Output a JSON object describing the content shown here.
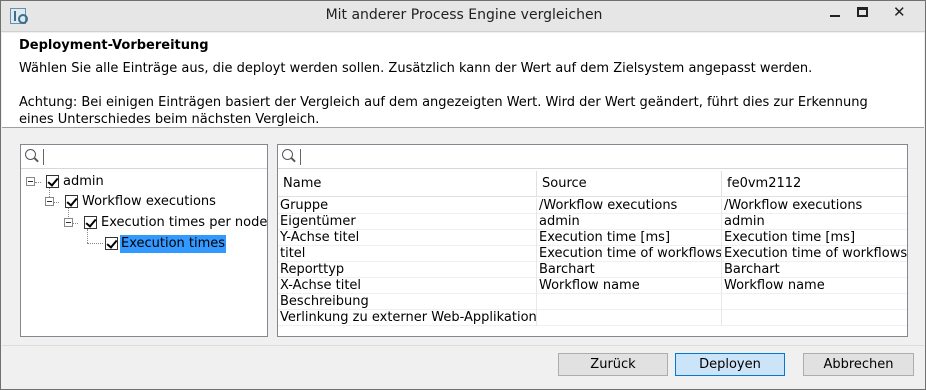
{
  "window": {
    "title": "Mit anderer Process Engine vergleichen",
    "close_glyph": "✕"
  },
  "header": {
    "title": "Deployment-Vorbereitung",
    "description": "Wählen Sie alle Einträge aus, die deployt werden sollen. Zusätzlich kann der Wert auf dem Zielsystem angepasst werden.",
    "warning": "Achtung: Bei einigen Einträgen basiert der Vergleich auf dem angezeigten Wert. Wird der Wert geändert, führt dies zur Erkennung eines Unterschiedes beim nächsten Vergleich."
  },
  "tree": {
    "items": [
      {
        "label": "admin",
        "checked": true,
        "expanded": true,
        "level": 0
      },
      {
        "label": "Workflow executions",
        "checked": true,
        "expanded": true,
        "level": 1
      },
      {
        "label": "Execution times per node",
        "checked": true,
        "expanded": true,
        "level": 2
      },
      {
        "label": "Execution times",
        "checked": true,
        "selected": true,
        "level": 3
      }
    ]
  },
  "table": {
    "columns": [
      "Name",
      "Source",
      "fe0vm2112"
    ],
    "rows": [
      [
        "Gruppe",
        "/Workflow executions",
        "/Workflow executions"
      ],
      [
        "Eigentümer",
        "admin",
        "admin"
      ],
      [
        "Y-Achse titel",
        "Execution time [ms]",
        "Execution time [ms]"
      ],
      [
        "titel",
        "Execution time of workflows",
        "Execution time of workflows"
      ],
      [
        "Reporttyp",
        "Barchart",
        "Barchart"
      ],
      [
        "X-Achse titel",
        "Workflow name",
        "Workflow name"
      ],
      [
        "Beschreibung",
        "",
        ""
      ],
      [
        "Verlinkung zu externer Web-Applikation",
        "",
        ""
      ]
    ]
  },
  "buttons": {
    "back": "Zurück",
    "deploy": "Deployen",
    "cancel": "Abbrechen"
  },
  "colors": {
    "selection": "#3399ff",
    "default_button": "#cce4f7"
  }
}
